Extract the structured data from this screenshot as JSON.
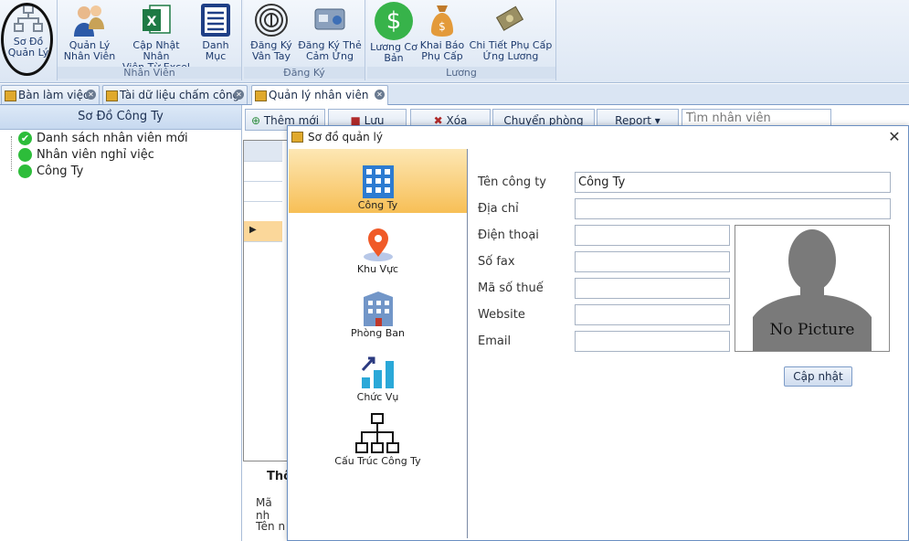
{
  "ribbon": {
    "groups": [
      {
        "label": ""
      },
      {
        "label": "Nhân Viên"
      },
      {
        "label": "Đăng Ký"
      },
      {
        "label": "Lương"
      }
    ],
    "buttons": {
      "so_do_1": "Sơ Đồ",
      "so_do_2": "Quản Lý",
      "quan_ly_1": "Quản Lý",
      "quan_ly_2": "Nhân Viên",
      "cap_nhat_1": "Cập Nhật Nhân",
      "cap_nhat_2": "Viên Từ Excel",
      "danh_muc_1": "Danh",
      "danh_muc_2": "Mục",
      "dang_ky_van_tay_1": "Đăng Ký",
      "dang_ky_van_tay_2": "Vân Tay",
      "dang_ky_the_1": "Đăng Ký Thẻ",
      "dang_ky_the_2": "Cảm Ứng",
      "luong_co_ban_1": "Lương Cơ",
      "luong_co_ban_2": "Bản",
      "khai_bao_1": "Khai Báo",
      "khai_bao_2": "Phụ Cấp",
      "chi_tiet_1": "Chi Tiết Phụ Cấp",
      "chi_tiet_2": "Ứng Lương"
    }
  },
  "tabs": [
    {
      "label": "Bàn làm việc"
    },
    {
      "label": "Tài dữ liệu chấm công"
    },
    {
      "label": "Quản lý nhân viên"
    }
  ],
  "left_panel": {
    "title": "Sơ Đồ Công Ty",
    "items": [
      {
        "label": "Danh sách nhân viên mới"
      },
      {
        "label": "Nhân viên nghỉ việc"
      },
      {
        "label": "Công Ty"
      }
    ]
  },
  "toolbar": {
    "add": "Thêm mới",
    "save": "Lưu",
    "delete": "Xóa",
    "transfer": "Chuyển phòng ban",
    "report": "Report",
    "search_placeholder": "Tìm nhân viên"
  },
  "behind": {
    "tab_fragment": "Thô",
    "label1": "Mã nh",
    "label2": "Tên n"
  },
  "dialog": {
    "title": "Sơ đồ quản lý",
    "close": "✕",
    "nav": [
      {
        "label": "Công Ty"
      },
      {
        "label": "Khu Vực"
      },
      {
        "label": "Phòng Ban"
      },
      {
        "label": "Chức Vụ"
      },
      {
        "label": "Cấu Trúc Công Ty"
      }
    ],
    "fields": {
      "company_name_label": "Tên công ty",
      "company_name_value": "Công Ty",
      "address_label": "Địa chỉ",
      "phone_label": "Điện thoại",
      "fax_label": "Số fax",
      "tax_label": "Mã số thuế",
      "website_label": "Website",
      "email_label": "Email"
    },
    "photo_text": "No Picture",
    "update_button": "Cập nhật"
  },
  "colors": {
    "ribbon_bg": "#dde7f4",
    "nav_selected": "#f7bf56",
    "status_green": "#2dbd3a"
  }
}
